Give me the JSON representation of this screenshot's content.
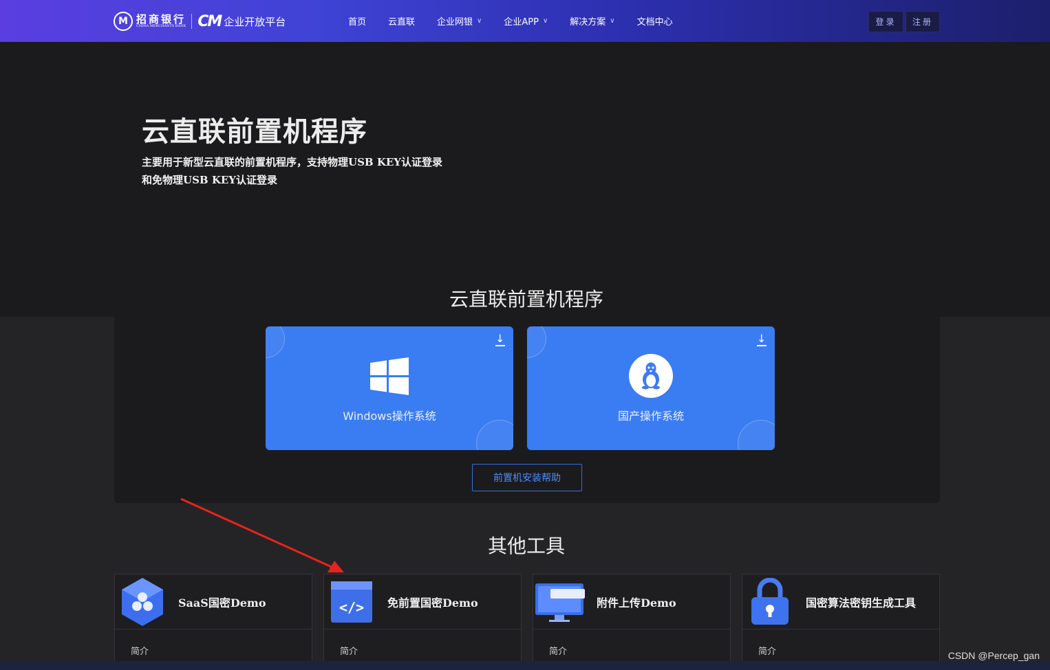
{
  "nav": {
    "logo": {
      "bank_cn": "招商银行",
      "bank_en": "CHINA MERCHANTS BANK",
      "platform": "企业开放平台"
    },
    "items": [
      {
        "label": "首页",
        "has_dropdown": false
      },
      {
        "label": "云直联",
        "has_dropdown": false
      },
      {
        "label": "企业网银",
        "has_dropdown": true
      },
      {
        "label": "企业APP",
        "has_dropdown": true
      },
      {
        "label": "解决方案",
        "has_dropdown": true
      },
      {
        "label": "文档中心",
        "has_dropdown": false
      }
    ],
    "login_label": "登录",
    "register_label": "注册"
  },
  "hero": {
    "title": "云直联前置机程序",
    "description": "主要用于新型云直联的前置机程序，支持物理USB KEY认证登录和免物理USB KEY认证登录"
  },
  "downloads": {
    "section_title": "云直联前置机程序",
    "cards": [
      {
        "label": "Windows操作系统",
        "icon": "windows-icon"
      },
      {
        "label": "国产操作系统",
        "icon": "linux-penguin-icon"
      }
    ],
    "help_label": "前置机安装帮助"
  },
  "tools": {
    "section_title": "其他工具",
    "cards": [
      {
        "name": "SaaS国密Demo",
        "intro": "简介",
        "icon": "hexagon-cubes-icon"
      },
      {
        "name": "免前置国密Demo",
        "intro": "简介",
        "icon": "code-window-icon"
      },
      {
        "name": "附件上传Demo",
        "intro": "简介",
        "icon": "monitor-icon"
      },
      {
        "name": "国密算法密钥生成工具",
        "intro": "简介",
        "icon": "padlock-icon"
      }
    ]
  },
  "watermark": "CSDN @Percep_gan",
  "colors": {
    "accent": "#3a7cf2",
    "nav_start": "#5a3ee0",
    "nav_end": "#1c1f6b",
    "annotation": "#e8231d"
  }
}
